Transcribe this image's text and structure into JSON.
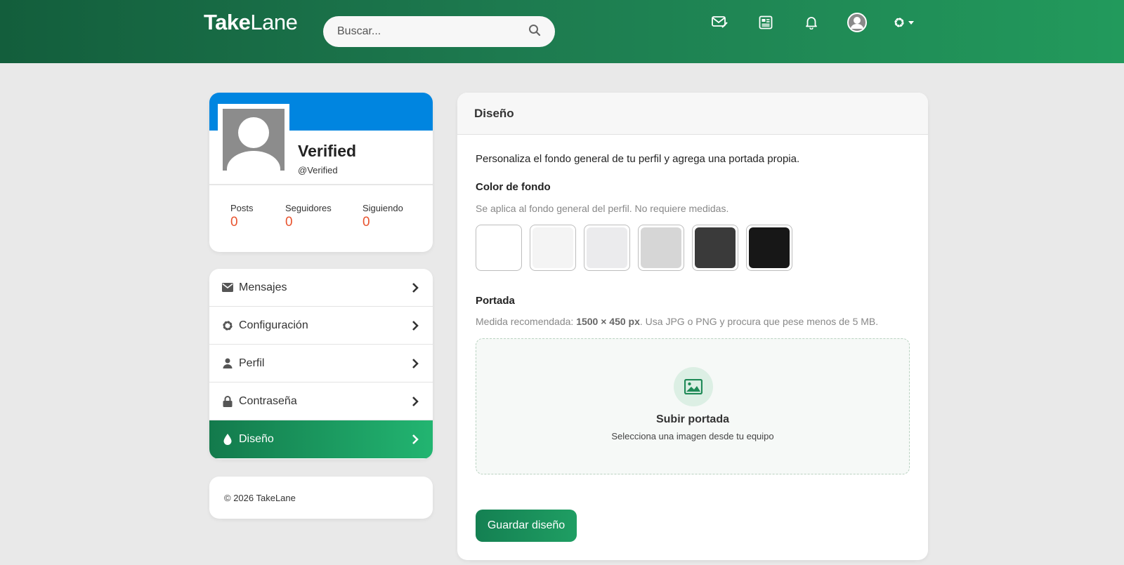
{
  "header": {
    "logo_bold": "Take",
    "logo_light": "Lane",
    "search_placeholder": "Buscar...",
    "icons": [
      "compose-mail-icon",
      "news-icon",
      "bell-icon",
      "user-avatar-icon",
      "gear-dropdown-icon"
    ]
  },
  "profile": {
    "name": "Verified",
    "handle": "@Verified",
    "stats": [
      {
        "label": "Posts",
        "value": "0"
      },
      {
        "label": "Seguidores",
        "value": "0"
      },
      {
        "label": "Siguiendo",
        "value": "0"
      }
    ]
  },
  "menu": [
    {
      "label": "Mensajes",
      "icon": "envelope-icon",
      "active": false
    },
    {
      "label": "Configuración",
      "icon": "gear-icon",
      "active": false
    },
    {
      "label": "Perfil",
      "icon": "user-icon",
      "active": false
    },
    {
      "label": "Contraseña",
      "icon": "lock-icon",
      "active": false
    },
    {
      "label": "Diseño",
      "icon": "drop-icon",
      "active": true
    }
  ],
  "footer": {
    "text": "© 2026 TakeLane"
  },
  "panel": {
    "title": "Diseño",
    "intro": "Personaliza el fondo general de tu perfil y agrega una portada propia.",
    "bg_title": "Color de fondo",
    "bg_help": "Se aplica al fondo general del perfil. No requiere medidas.",
    "swatches": [
      "#ffffff",
      "#f4f4f4",
      "#ebebed",
      "#d6d6d6",
      "#3a3a3a",
      "#171717"
    ],
    "cover_title": "Portada",
    "cover_help_prefix": "Medida recomendada: ",
    "cover_help_size": "1500 × 450 px",
    "cover_help_suffix": ". Usa JPG o PNG y procura que pese menos de 5 MB.",
    "upload_title": "Subir portada",
    "upload_sub": "Selecciona una imagen desde tu equipo",
    "save_label": "Guardar diseño"
  },
  "colors": {
    "accent_green": "#1f9e63",
    "cover_blue": "#0085e0",
    "stat_orange": "#e8542f"
  }
}
